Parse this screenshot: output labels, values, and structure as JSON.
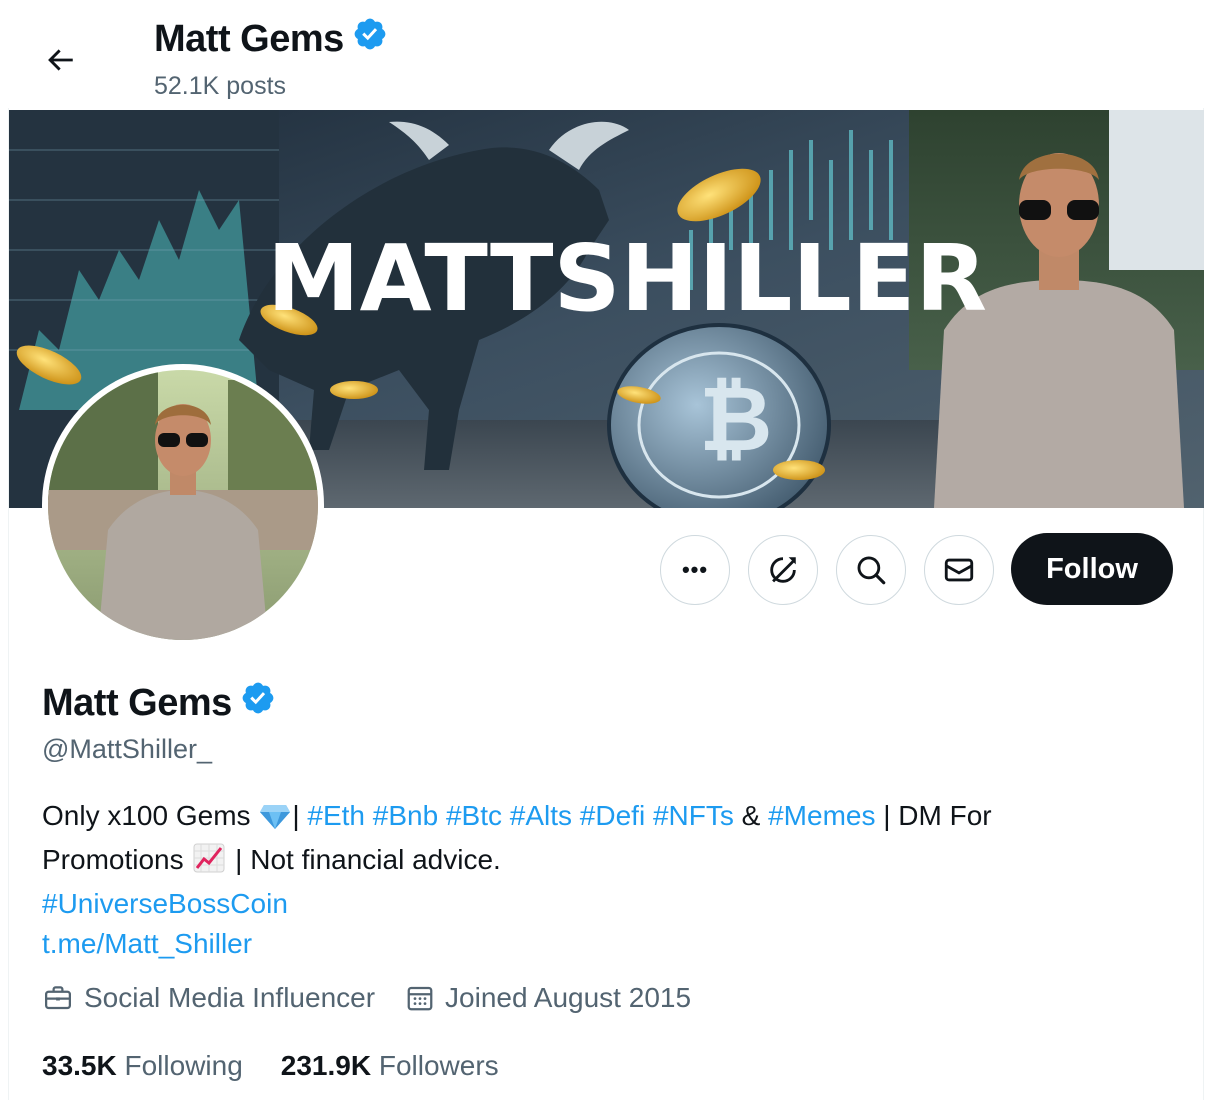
{
  "header": {
    "name": "Matt Gems",
    "posts": "52.1K posts"
  },
  "banner": {
    "text": "MATTSHILLER"
  },
  "actions": {
    "more_label": "•••",
    "follow_label": "Follow"
  },
  "profile": {
    "name": "Matt Gems",
    "handle": "@MattShiller_",
    "bio": {
      "line1_prefix": "Only x100 Gems ",
      "line1_sep1": "| ",
      "hashtags": [
        "#Eth",
        "#Bnb",
        "#Btc",
        "#Alts",
        "#Defi",
        "#NFTs"
      ],
      "amp": " & ",
      "memes": "#Memes",
      "line1_suffix": " | DM For",
      "line2_prefix": "Promotions ",
      "line2_suffix": " | Not financial advice.",
      "line3": "#UniverseBossCoin",
      "line4": "t.me/Matt_Shiller"
    },
    "category": "Social Media Influencer",
    "joined": "Joined August 2015",
    "following_count": "33.5K",
    "following_label": "Following",
    "followers_count": "231.9K",
    "followers_label": "Followers"
  },
  "colors": {
    "accent": "#1d9bf0",
    "text": "#0f1419",
    "secondary": "#536471",
    "verified": "#1d9bf0"
  }
}
